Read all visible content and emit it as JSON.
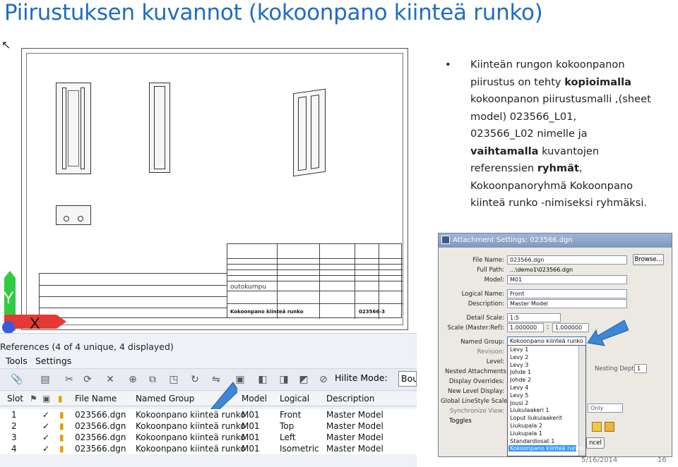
{
  "slide": {
    "title": "Piirustuksen kuvannot (kokoonpano kiinteä runko)",
    "bullet_lines": [
      {
        "parts": [
          {
            "text": "Kiinteän rungon kokoonpanon",
            "bold": false
          }
        ]
      },
      {
        "parts": [
          {
            "text": "piirustus on tehty ",
            "bold": false
          },
          {
            "text": "kopioimalla",
            "bold": true
          }
        ]
      },
      {
        "parts": [
          {
            "text": "kokoonpanon piirustusmalli ,(sheet",
            "bold": false
          }
        ]
      },
      {
        "parts": [
          {
            "text": "model) 023566_L01,",
            "bold": false
          }
        ]
      },
      {
        "parts": [
          {
            "text": "023566_L02 nimelle ja",
            "bold": false
          }
        ]
      },
      {
        "parts": [
          {
            "text": "vaihtamalla",
            "bold": true
          },
          {
            "text": " kuvantojen",
            "bold": false
          }
        ]
      },
      {
        "parts": [
          {
            "text": "referenssien ",
            "bold": false
          },
          {
            "text": "ryhmät",
            "bold": true
          },
          {
            "text": ",",
            "bold": false
          }
        ]
      },
      {
        "parts": [
          {
            "text": "Kokoonpanoryhmä Kokoonpano",
            "bold": false
          }
        ]
      },
      {
        "parts": [
          {
            "text": "kiinteä runko -nimiseksi ryhmäksi.",
            "bold": false
          }
        ]
      }
    ],
    "footer_date": "5/16/2014",
    "footer_page": "16"
  },
  "drawing": {
    "titleblock_company": "outokumpu",
    "titleblock_doc": "023566-3",
    "titleblock_name": "Kokoonpano kiinteä runko",
    "axis_y": "Y",
    "axis_x": "X"
  },
  "references": {
    "title": "References (4 of 4 unique, 4 displayed)",
    "menu": [
      "Tools",
      "Settings"
    ],
    "hilite_label": "Hilite Mode:",
    "hilite_value": "Boundaries",
    "columns": [
      "Slot",
      "File Name",
      "Named Group",
      "Model",
      "Logical",
      "Description"
    ],
    "rows": [
      {
        "slot": "1",
        "check": "✓",
        "file": "023566.dgn",
        "group": "Kokoonpano kiinteä runko",
        "model": "M01",
        "logical": "Front",
        "desc": "Master Model"
      },
      {
        "slot": "2",
        "check": "✓",
        "file": "023566.dgn",
        "group": "Kokoonpano kiinteä runko",
        "model": "M01",
        "logical": "Top",
        "desc": "Master Model"
      },
      {
        "slot": "3",
        "check": "✓",
        "file": "023566.dgn",
        "group": "Kokoonpano kiinteä runko",
        "model": "M01",
        "logical": "Left",
        "desc": "Master Model"
      },
      {
        "slot": "4",
        "check": "✓",
        "file": "023566.dgn",
        "group": "Kokoonpano kiinteä runko",
        "model": "M01",
        "logical": "Isometric",
        "desc": "Master Model"
      }
    ]
  },
  "dialog": {
    "title": "Attachment Settings: 023566.dgn",
    "file_name_label": "File Name:",
    "file_name": "023566.dgn",
    "browse": "Browse...",
    "full_path_label": "Full Path:",
    "full_path": "...\\demo1\\023566.dgn",
    "model_label": "Model:",
    "model": "M01",
    "logical_name_label": "Logical Name:",
    "logical_name": "Front",
    "description_label": "Description:",
    "description": "Master Model",
    "detail_scale_label": "Detail Scale:",
    "detail_scale": "1:5",
    "scale_label": "Scale (Master:Ref):",
    "scale_a": "1.000000",
    "scale_sep": ":",
    "scale_b": "1.000000",
    "named_group_label": "Named Group:",
    "named_group": "Kokoonpano kiinteä runko",
    "revision_label": "Revision:",
    "level_label": "Level:",
    "nested_label": "Nested Attachments:",
    "display_overrides_label": "Display Overrides:",
    "new_level_label": "New Level Display:",
    "global_linestyle_label": "Global LineStyle Scale:",
    "sync_view_label": "Synchronize View:",
    "toggles_label": "Toggles",
    "nesting_depth_label": "Nesting Depth:",
    "nesting_depth": "1",
    "only_value": "Only",
    "cancel": "ncel",
    "options": [
      "Levy 1",
      "Levy 2",
      "Levy 3",
      "Johde 1",
      "Johde 2",
      "Levy 4",
      "Levy 5",
      "Jousi 2",
      "Liukulaakeri 1",
      "Loput liukulaakerit",
      "Liukupala 2",
      "Liukupala 1",
      "Standardiosat 1",
      "Kokoonpano kiinteä runko"
    ]
  },
  "colors": {
    "title": "#1f6dc0",
    "arrow": "#3d86d8",
    "selected": "#3399ff"
  }
}
